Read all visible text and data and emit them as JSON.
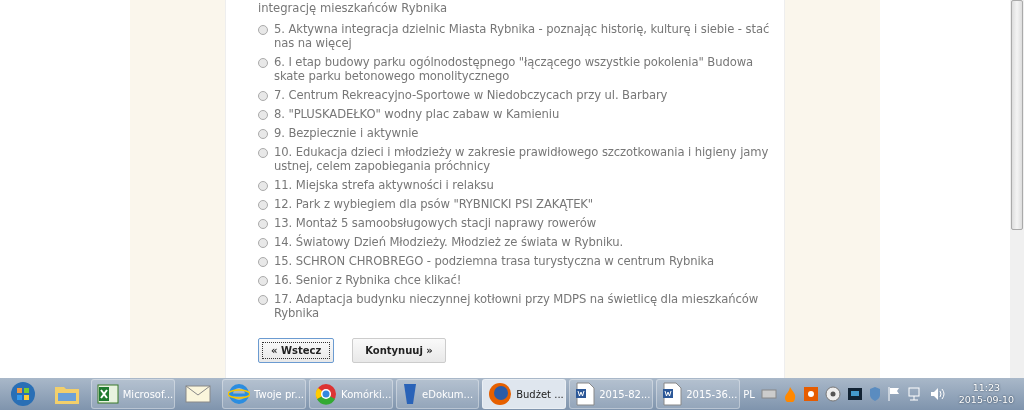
{
  "form": {
    "lead_text": "integrację mieszkańców Rybnika",
    "options": [
      {
        "label": "5. Aktywna integracja dzielnic Miasta Rybnika - poznając historię, kulturę i siebie - stać nas na więcej",
        "selected": false
      },
      {
        "label": "6. I etap budowy parku ogólnodostępnego \"łączącego wszystkie pokolenia\" Budowa skate parku betonowego monolitycznego",
        "selected": false
      },
      {
        "label": "7. Centrum Rekreacyjno-Sportowe w Niedobczycach przy ul. Barbary",
        "selected": false
      },
      {
        "label": "8. \"PLUSKADEŁKO\" wodny plac zabaw w Kamieniu",
        "selected": false
      },
      {
        "label": "9. Bezpiecznie i aktywnie",
        "selected": false
      },
      {
        "label": "10. Edukacja dzieci i młodzieży w zakresie prawidłowego szczotkowania i higieny jamy ustnej, celem zapobiegania próchnicy",
        "selected": false
      },
      {
        "label": "11. Miejska strefa aktywności i relaksu",
        "selected": false
      },
      {
        "label": "12. Park z wybiegiem dla psów \"RYBNICKI PSI ZAKĄTEK\"",
        "selected": false
      },
      {
        "label": "13. Montaż 5 samoobsługowych stacji naprawy rowerów",
        "selected": false
      },
      {
        "label": "14. Światowy Dzień Młodzieży. Młodzież ze świata w Rybniku.",
        "selected": false
      },
      {
        "label": "15. SCHRON CHROBREGO - podziemna trasa turystyczna w centrum Rybnika",
        "selected": false
      },
      {
        "label": "16. Senior z Rybnika chce klikać!",
        "selected": false
      },
      {
        "label": "17. Adaptacja budynku nieczynnej kotłowni przy MDPS na świetlicę dla mieszkańców Rybnika",
        "selected": false
      }
    ],
    "buttons": [
      {
        "label": "« Wstecz",
        "focused": true
      },
      {
        "label": "Kontynuuj »",
        "focused": false
      }
    ]
  },
  "taskbar": {
    "items": [
      {
        "kind": "start"
      },
      {
        "kind": "folder"
      },
      {
        "kind": "excel",
        "label": "Microsof...",
        "selected": false
      },
      {
        "kind": "mail"
      },
      {
        "kind": "ie",
        "label": "Twoje pr...",
        "selected": false
      },
      {
        "kind": "chrome",
        "label": "Komórki...",
        "selected": false
      },
      {
        "kind": "edok",
        "label": "eDokum...",
        "selected": false
      },
      {
        "kind": "firefox",
        "label": "Budżet ...",
        "selected": true
      },
      {
        "kind": "word",
        "label": "2015-82...",
        "selected": false
      },
      {
        "kind": "word",
        "label": "2015-36...",
        "selected": false
      }
    ],
    "language": "PL",
    "time": "11:23",
    "date": "2015-09-10"
  }
}
